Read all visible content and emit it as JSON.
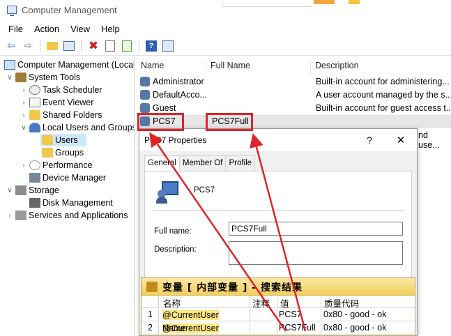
{
  "window": {
    "title": "Computer Management"
  },
  "menu": [
    "File",
    "Action",
    "View",
    "Help"
  ],
  "toolbar_icons": [
    "back-icon",
    "forward-icon",
    "up-folder-icon",
    "show-hide-tree-icon",
    "delete-icon",
    "properties-icon",
    "export-icon",
    "help-icon",
    "view-icon"
  ],
  "tree": {
    "root": "Computer Management (Local",
    "items": [
      {
        "label": "System Tools"
      },
      {
        "label": "Task Scheduler"
      },
      {
        "label": "Event Viewer"
      },
      {
        "label": "Shared Folders"
      },
      {
        "label": "Local Users and Groups"
      },
      {
        "label": "Users"
      },
      {
        "label": "Groups"
      },
      {
        "label": "Performance"
      },
      {
        "label": "Device Manager"
      },
      {
        "label": "Storage"
      },
      {
        "label": "Disk Management"
      },
      {
        "label": "Services and Applications"
      }
    ]
  },
  "list": {
    "columns": [
      "Name",
      "Full Name",
      "Description"
    ],
    "rows": [
      {
        "name": "Administrator",
        "full_name": "",
        "description": "Built-in account for administering..."
      },
      {
        "name": "DefaultAcco...",
        "full_name": "",
        "description": "A user account managed by the s..."
      },
      {
        "name": "Guest",
        "full_name": "",
        "description": "Built-in account for guest access t..."
      },
      {
        "name": "PCS7",
        "full_name": "PCS7Full",
        "description": ""
      }
    ],
    "hidden_fragment": "nd use..."
  },
  "dialog": {
    "title": "PCS7 Properties",
    "help_label": "?",
    "close_label": "✕",
    "tabs": [
      "General",
      "Member Of",
      "Profile"
    ],
    "username": "PCS7",
    "full_name_label": "Full name:",
    "full_name_value": "PCS7Full",
    "description_label": "Description:",
    "description_value": ""
  },
  "variable_panel": {
    "title": "变量 [ 内部变量 ] - 搜索结果",
    "columns": [
      "名称",
      "注释",
      "值",
      "质量代码"
    ],
    "rows": [
      {
        "index": "1",
        "name_hl": "@CurrentUser",
        "name_rest": "",
        "comment": "",
        "value": "PCS7",
        "quality": "0x80 - good - ok"
      },
      {
        "index": "2",
        "name_hl": "@CurrentUser",
        "name_rest": "Name",
        "comment": "",
        "value": "PCS7Full",
        "quality": "0x80 - good - ok"
      }
    ]
  },
  "colors": {
    "annotation": "#e0232a",
    "selection": "#cce8ff",
    "highlight": "#ffe680"
  }
}
